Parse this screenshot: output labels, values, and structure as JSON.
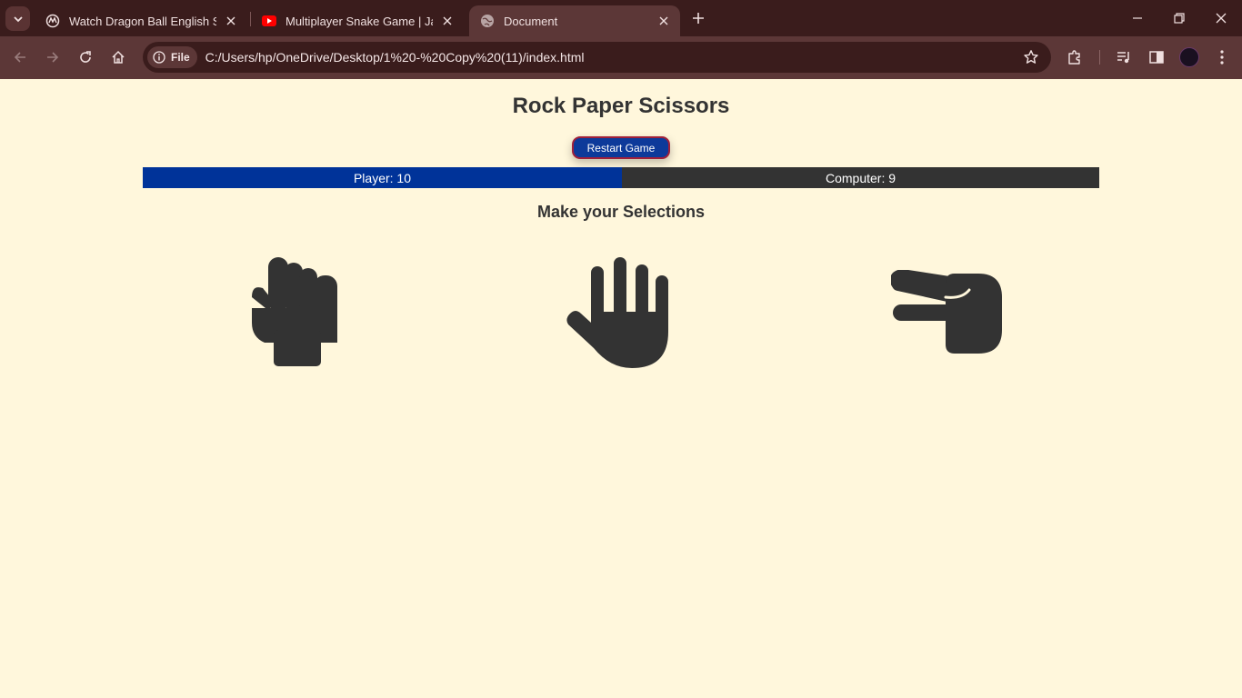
{
  "browser": {
    "tabs": [
      {
        "title": "Watch Dragon Ball English Sub/",
        "icon": "anime-site-icon",
        "active": false
      },
      {
        "title": "Multiplayer Snake Game | JavaS",
        "icon": "youtube-icon",
        "active": false
      },
      {
        "title": "Document",
        "icon": "globe-icon",
        "active": true
      }
    ],
    "address_chip": "File",
    "url": "C:/Users/hp/OneDrive/Desktop/1%20-%20Copy%20(11)/index.html"
  },
  "page": {
    "title": "Rock Paper Scissors",
    "restart_label": "Restart Game",
    "player_score": "Player: 10",
    "computer_score": "Computer: 9",
    "prompt": "Make your Selections",
    "choices": [
      {
        "name": "rock",
        "icon": "fist-icon"
      },
      {
        "name": "paper",
        "icon": "open-hand-icon"
      },
      {
        "name": "scissors",
        "icon": "scissors-hand-icon"
      }
    ]
  },
  "colors": {
    "page_background": "#fff7dc",
    "player_bar": "#003399",
    "computer_bar": "#333333",
    "button": "#0d3a9a",
    "icon": "#333333",
    "chrome_dark": "#3a1c1c",
    "chrome_light": "#5c3737"
  }
}
